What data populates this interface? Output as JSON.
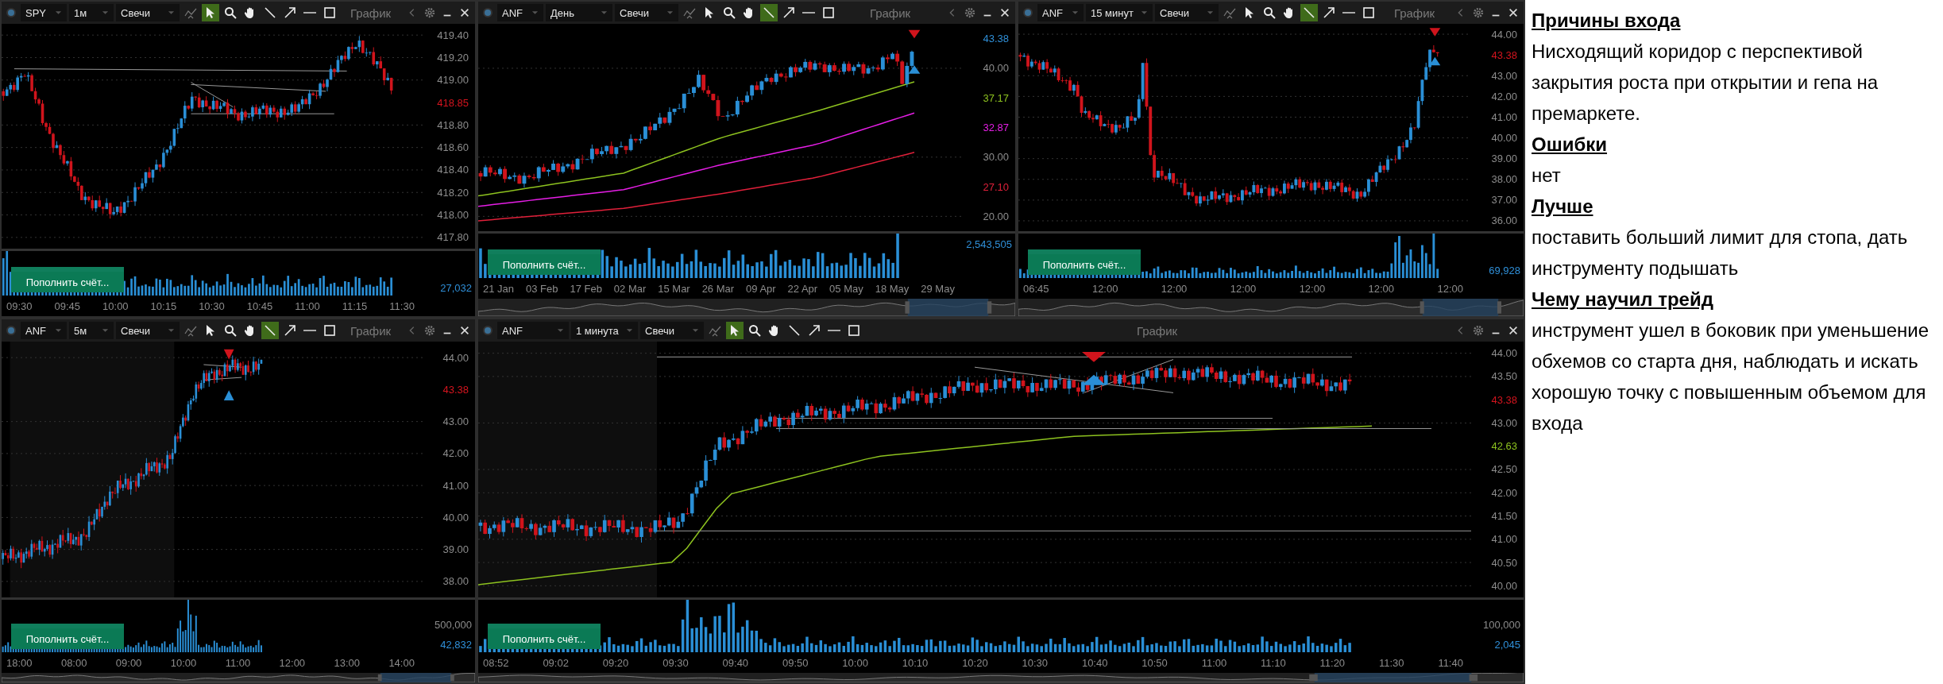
{
  "panels": [
    {
      "symbol": "SPY",
      "timeframe": "1м",
      "chart_style": "Свечи",
      "title": "График",
      "navigator": false,
      "tools": [
        {
          "kind": "indicators",
          "selected": false
        },
        {
          "kind": "cursor",
          "selected": true
        },
        {
          "kind": "zoom",
          "selected": false
        },
        {
          "kind": "hand",
          "selected": false
        },
        {
          "kind": "line",
          "selected": false
        },
        {
          "kind": "arrow",
          "selected": false
        },
        {
          "kind": "hline",
          "selected": false
        },
        {
          "kind": "rect",
          "selected": false
        }
      ],
      "y_labels": [
        {
          "text": "419.40",
          "kind": "tick"
        },
        {
          "text": "419.20",
          "kind": "tick"
        },
        {
          "text": "419.00",
          "kind": "tick"
        },
        {
          "text": "418.85",
          "kind": "price",
          "color": "#d4141e"
        },
        {
          "text": "418.80",
          "kind": "tick"
        },
        {
          "text": "418.60",
          "kind": "tick"
        },
        {
          "text": "418.40",
          "kind": "tick"
        },
        {
          "text": "418.20",
          "kind": "tick"
        },
        {
          "text": "418.00",
          "kind": "tick"
        },
        {
          "text": "417.80",
          "kind": "tick"
        }
      ],
      "volume_labels": [
        {
          "text": "27,032",
          "kind": "last"
        }
      ],
      "x_labels": [
        "09:30",
        "09:45",
        "10:00",
        "10:15",
        "10:30",
        "10:45",
        "11:00",
        "11:15",
        "11:30"
      ],
      "deposit_button": "Пополнить счёт..."
    },
    {
      "symbol": "ANF",
      "timeframe": "День",
      "chart_style": "Свечи",
      "title": "График",
      "navigator": true,
      "tools": [
        {
          "kind": "indicators",
          "selected": false
        },
        {
          "kind": "cursor",
          "selected": false
        },
        {
          "kind": "zoom",
          "selected": false
        },
        {
          "kind": "hand",
          "selected": false
        },
        {
          "kind": "line",
          "selected": true
        },
        {
          "kind": "arrow",
          "selected": false
        },
        {
          "kind": "hline",
          "selected": false
        },
        {
          "kind": "rect",
          "selected": false
        }
      ],
      "y_labels": [
        {
          "text": "43.38",
          "kind": "price",
          "color": "#2f8fd8"
        },
        {
          "text": "40.00",
          "kind": "tick"
        },
        {
          "text": "37.17",
          "kind": "ma",
          "color": "#8dc21f"
        },
        {
          "text": "32.87",
          "kind": "ma",
          "color": "#e61ee6"
        },
        {
          "text": "30.00",
          "kind": "tick"
        },
        {
          "text": "27.10",
          "kind": "ma",
          "color": "#e0203a"
        },
        {
          "text": "20.00",
          "kind": "tick"
        }
      ],
      "volume_labels": [
        {
          "text": "2,543,505",
          "kind": "last"
        }
      ],
      "x_labels": [
        "21 Jan",
        "03 Feb",
        "17 Feb",
        "02 Mar",
        "15 Mar",
        "26 Mar",
        "09 Apr",
        "22 Apr",
        "05 May",
        "18 May",
        "29 May"
      ],
      "deposit_button": "Пополнить счёт..."
    },
    {
      "symbol": "ANF",
      "timeframe": "15 минут",
      "chart_style": "Свечи",
      "title": "График",
      "navigator": true,
      "tools": [
        {
          "kind": "indicators",
          "selected": false
        },
        {
          "kind": "cursor",
          "selected": false
        },
        {
          "kind": "zoom",
          "selected": false
        },
        {
          "kind": "hand",
          "selected": false
        },
        {
          "kind": "line",
          "selected": true
        },
        {
          "kind": "arrow",
          "selected": false
        },
        {
          "kind": "hline",
          "selected": false
        },
        {
          "kind": "rect",
          "selected": false
        }
      ],
      "y_labels": [
        {
          "text": "44.00",
          "kind": "tick"
        },
        {
          "text": "43.38",
          "kind": "price",
          "color": "#d4141e"
        },
        {
          "text": "43.00",
          "kind": "tick"
        },
        {
          "text": "42.00",
          "kind": "tick"
        },
        {
          "text": "41.00",
          "kind": "tick"
        },
        {
          "text": "40.00",
          "kind": "tick"
        },
        {
          "text": "39.00",
          "kind": "tick"
        },
        {
          "text": "38.00",
          "kind": "tick"
        },
        {
          "text": "37.00",
          "kind": "tick"
        },
        {
          "text": "36.00",
          "kind": "tick"
        }
      ],
      "volume_labels": [
        {
          "text": "69,928",
          "kind": "last"
        }
      ],
      "x_labels": [
        "06:45",
        "12:00",
        "12:00",
        "12:00",
        "12:00",
        "12:00",
        "12:00"
      ],
      "deposit_button": "Пополнить счёт..."
    },
    {
      "symbol": "ANF",
      "timeframe": "5м",
      "chart_style": "Свечи",
      "title": "График",
      "navigator": true,
      "tools": [
        {
          "kind": "indicators",
          "selected": false
        },
        {
          "kind": "cursor",
          "selected": false
        },
        {
          "kind": "zoom",
          "selected": false
        },
        {
          "kind": "hand",
          "selected": false
        },
        {
          "kind": "line",
          "selected": true
        },
        {
          "kind": "arrow",
          "selected": false
        },
        {
          "kind": "hline",
          "selected": false
        },
        {
          "kind": "rect",
          "selected": false
        }
      ],
      "y_labels": [
        {
          "text": "44.00",
          "kind": "tick"
        },
        {
          "text": "43.38",
          "kind": "price",
          "color": "#d4141e"
        },
        {
          "text": "43.00",
          "kind": "tick"
        },
        {
          "text": "42.00",
          "kind": "tick"
        },
        {
          "text": "41.00",
          "kind": "tick"
        },
        {
          "text": "40.00",
          "kind": "tick"
        },
        {
          "text": "39.00",
          "kind": "tick"
        },
        {
          "text": "38.00",
          "kind": "tick"
        }
      ],
      "volume_labels": [
        {
          "text": "500,000",
          "kind": "tick"
        },
        {
          "text": "42,832",
          "kind": "last"
        }
      ],
      "x_labels": [
        "18:00",
        "08:00",
        "09:00",
        "10:00",
        "11:00",
        "12:00",
        "13:00",
        "14:00"
      ],
      "deposit_button": "Пополнить счёт..."
    },
    {
      "symbol": "ANF",
      "timeframe": "1 минута",
      "chart_style": "Свечи",
      "title": "График",
      "navigator": true,
      "tools": [
        {
          "kind": "indicators",
          "selected": false
        },
        {
          "kind": "cursor",
          "selected": true
        },
        {
          "kind": "zoom",
          "selected": false
        },
        {
          "kind": "hand",
          "selected": false
        },
        {
          "kind": "line",
          "selected": false
        },
        {
          "kind": "arrow",
          "selected": false
        },
        {
          "kind": "hline",
          "selected": false
        },
        {
          "kind": "rect",
          "selected": false
        }
      ],
      "y_labels": [
        {
          "text": "44.00",
          "kind": "tick"
        },
        {
          "text": "43.50",
          "kind": "tick"
        },
        {
          "text": "43.38",
          "kind": "price",
          "color": "#d4141e"
        },
        {
          "text": "43.00",
          "kind": "tick"
        },
        {
          "text": "42.63",
          "kind": "ma",
          "color": "#8dc21f"
        },
        {
          "text": "42.50",
          "kind": "tick"
        },
        {
          "text": "42.00",
          "kind": "tick"
        },
        {
          "text": "41.50",
          "kind": "tick"
        },
        {
          "text": "41.00",
          "kind": "tick"
        },
        {
          "text": "40.50",
          "kind": "tick"
        },
        {
          "text": "40.00",
          "kind": "tick"
        }
      ],
      "volume_labels": [
        {
          "text": "100,000",
          "kind": "tick"
        },
        {
          "text": "2,045",
          "kind": "last"
        }
      ],
      "x_labels": [
        "08:52",
        "09:02",
        "09:20",
        "09:30",
        "09:40",
        "09:50",
        "10:00",
        "10:10",
        "10:20",
        "10:30",
        "10:40",
        "10:50",
        "11:00",
        "11:10",
        "11:20",
        "11:30",
        "11:40"
      ],
      "deposit_button": "Пополнить счёт..."
    }
  ],
  "notes": [
    {
      "heading": "Причины входа",
      "text": "Нисходящий коридор с перспективой закрытия роста при открытии и гепа на премаркете."
    },
    {
      "heading": "Ошибки",
      "text": "нет"
    },
    {
      "heading": "Лучше",
      "text": "поставить больший лимит для стопа, дать инструменту подышать"
    },
    {
      "heading": "Чему научил трейд",
      "text": "инструмент ушел в боковик при уменьшение обхемов со старта дня, наблюдать и искать хорошую точку с повышенным объемом для входа"
    }
  ]
}
